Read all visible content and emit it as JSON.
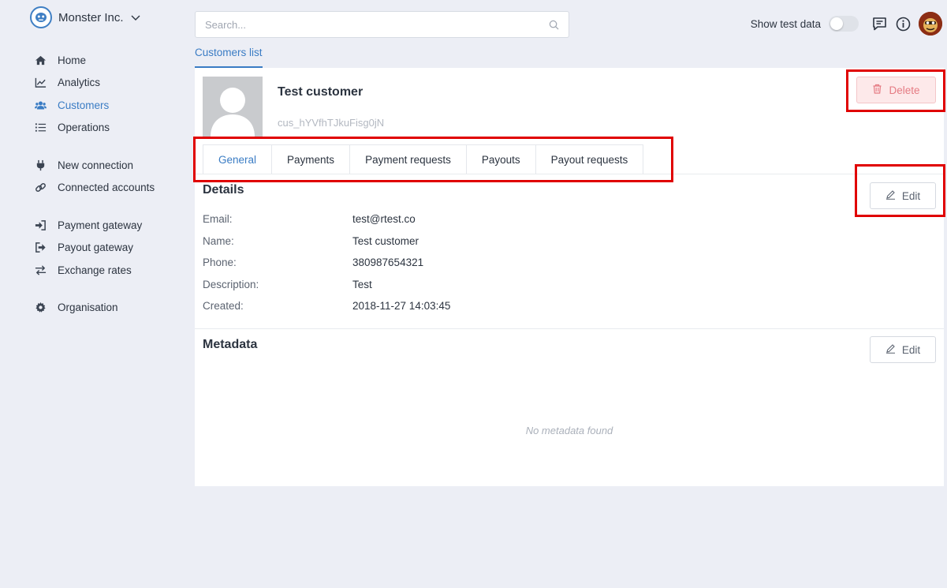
{
  "org": {
    "name": "Monster Inc."
  },
  "sidebar": {
    "items": [
      {
        "label": "Home",
        "icon": "home-icon"
      },
      {
        "label": "Analytics",
        "icon": "chart-icon"
      },
      {
        "label": "Customers",
        "icon": "users-icon",
        "active": true
      },
      {
        "label": "Operations",
        "icon": "list-icon"
      },
      {
        "label": "New connection",
        "icon": "plug-icon"
      },
      {
        "label": "Connected accounts",
        "icon": "link-icon"
      },
      {
        "label": "Payment gateway",
        "icon": "sign-in-icon"
      },
      {
        "label": "Payout gateway",
        "icon": "sign-out-icon"
      },
      {
        "label": "Exchange rates",
        "icon": "exchange-icon"
      },
      {
        "label": "Organisation",
        "icon": "gear-icon"
      }
    ]
  },
  "search": {
    "placeholder": "Search..."
  },
  "topbar": {
    "test_label": "Show test data",
    "test_on": false
  },
  "breadcrumb": {
    "label": "Customers list"
  },
  "customer": {
    "name": "Test customer",
    "id": "cus_hYVfhTJkuFisg0jN"
  },
  "actions": {
    "delete_label": "Delete",
    "edit_label": "Edit"
  },
  "tabs": [
    "General",
    "Payments",
    "Payment requests",
    "Payouts",
    "Payout requests"
  ],
  "details": {
    "title": "Details",
    "fields": [
      {
        "label": "Email:",
        "value": "test@rtest.co"
      },
      {
        "label": "Name:",
        "value": "Test customer"
      },
      {
        "label": "Phone:",
        "value": "380987654321"
      },
      {
        "label": "Description:",
        "value": "Test"
      },
      {
        "label": "Created:",
        "value": "2018-11-27 14:03:45"
      }
    ]
  },
  "metadata": {
    "title": "Metadata",
    "empty": "No metadata found"
  },
  "colors": {
    "accent": "#3a7cc4",
    "danger": "#e57b83",
    "highlight": "#e00000"
  }
}
